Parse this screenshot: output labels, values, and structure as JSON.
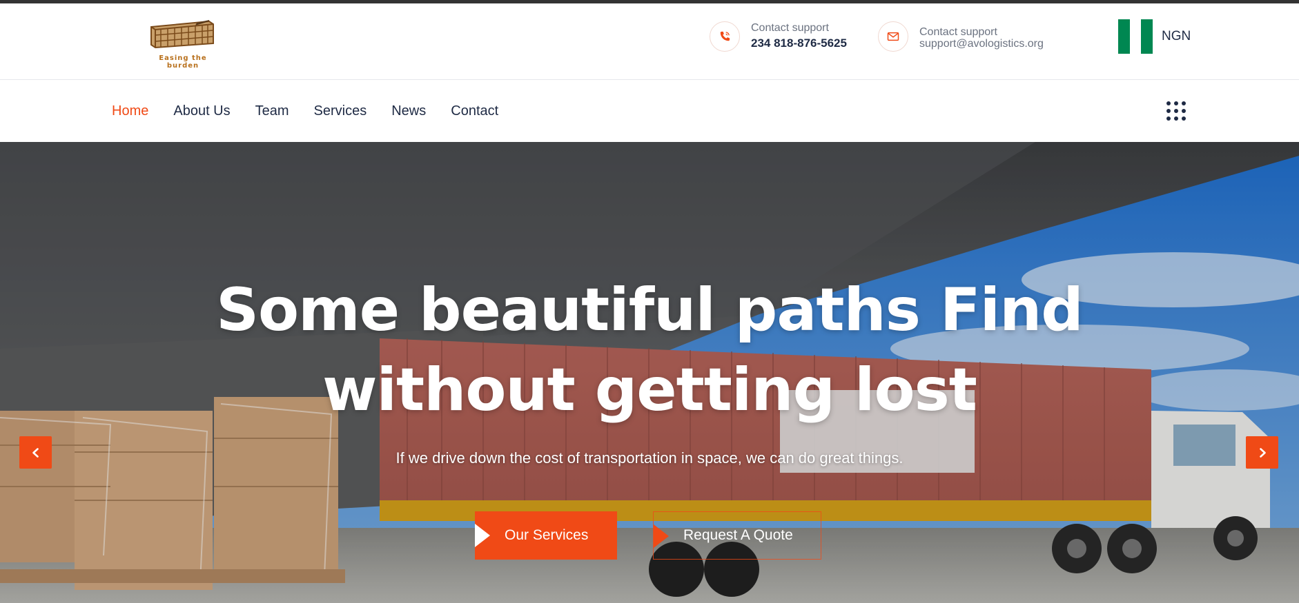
{
  "header": {
    "logo_tagline": "Easing the burden",
    "phone": {
      "label": "Contact support",
      "value": "234 818-876-5625",
      "icon": "phone-icon"
    },
    "email": {
      "label": "Contact support",
      "value": "support@avologistics.org",
      "icon": "mail-icon"
    },
    "currency": {
      "code": "NGN",
      "flag_colors": [
        "#008751",
        "#ffffff",
        "#008751"
      ]
    }
  },
  "nav": {
    "items": [
      {
        "label": "Home",
        "active": true
      },
      {
        "label": "About Us",
        "active": false
      },
      {
        "label": "Team",
        "active": false
      },
      {
        "label": "Services",
        "active": false
      },
      {
        "label": "News",
        "active": false
      },
      {
        "label": "Contact",
        "active": false
      }
    ],
    "menu_icon": "grid-dots-icon"
  },
  "hero": {
    "title": "Some beautiful paths Find without getting lost",
    "subtitle": "If we drive down the cost of transportation in space, we can do great things.",
    "primary_button": "Our Services",
    "secondary_button": "Request A Quote",
    "prev_icon": "chevron-left-icon",
    "next_icon": "chevron-right-icon"
  },
  "colors": {
    "accent": "#f04a16",
    "text_dark": "#1e2a44",
    "text_muted": "#6b7280"
  }
}
